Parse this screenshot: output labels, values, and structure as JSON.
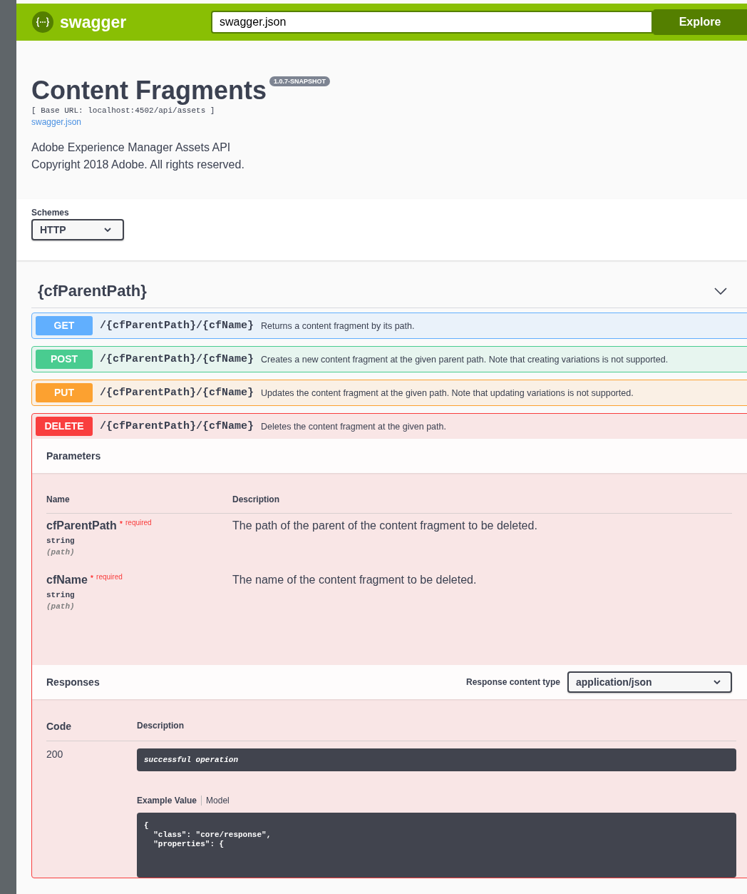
{
  "topbar": {
    "brand": "swagger",
    "url_input": "swagger.json",
    "explore_button": "Explore"
  },
  "info": {
    "title": "Content Fragments",
    "version": "1.0.7-SNAPSHOT",
    "base_url": "[ Base URL: localhost:4502/api/assets ]",
    "spec_link": "swagger.json",
    "description": [
      "Adobe Experience Manager Assets API",
      "Copyright 2018 Adobe. All rights reserved."
    ]
  },
  "schemes": {
    "label": "Schemes",
    "value": "HTTP"
  },
  "tag": {
    "name": "{cfParentPath}",
    "expanded": true
  },
  "operations": [
    {
      "method": "GET",
      "kind": "get",
      "path": "/{cfParentPath}/{cfName}",
      "summary": "Returns a content fragment by its path.",
      "expanded": false
    },
    {
      "method": "POST",
      "kind": "post",
      "path": "/{cfParentPath}/{cfName}",
      "summary": "Creates a new content fragment at the given parent path. Note that creating variations is not supported.",
      "expanded": false
    },
    {
      "method": "PUT",
      "kind": "put",
      "path": "/{cfParentPath}/{cfName}",
      "summary": "Updates the content fragment at the given path. Note that updating variations is not supported.",
      "expanded": false
    },
    {
      "method": "DELETE",
      "kind": "delete",
      "path": "/{cfParentPath}/{cfName}",
      "summary": "Deletes the content fragment at the given path.",
      "expanded": true
    }
  ],
  "parameters": {
    "title": "Parameters",
    "columns": [
      "Name",
      "Description"
    ],
    "rows": [
      {
        "name": "cfParentPath",
        "required_mark": "*",
        "required": "required",
        "type": "string",
        "location": "(path)",
        "description": "The path of the parent of the content fragment to be deleted."
      },
      {
        "name": "cfName",
        "required_mark": "*",
        "required": "required",
        "type": "string",
        "location": "(path)",
        "description": "The name of the content fragment to be deleted."
      }
    ]
  },
  "responses": {
    "title": "Responses",
    "content_type_label": "Response content type",
    "content_type": "application/json",
    "columns": [
      "Code",
      "Description"
    ],
    "rows": [
      {
        "code": "200",
        "description": "successful operation",
        "tabs": [
          {
            "label": "Example Value",
            "selected": true
          },
          {
            "label": "Model",
            "selected": false
          }
        ],
        "example": [
          "{",
          "  \"class\": \"core/response\",",
          "  \"properties\": {"
        ]
      }
    ]
  }
}
